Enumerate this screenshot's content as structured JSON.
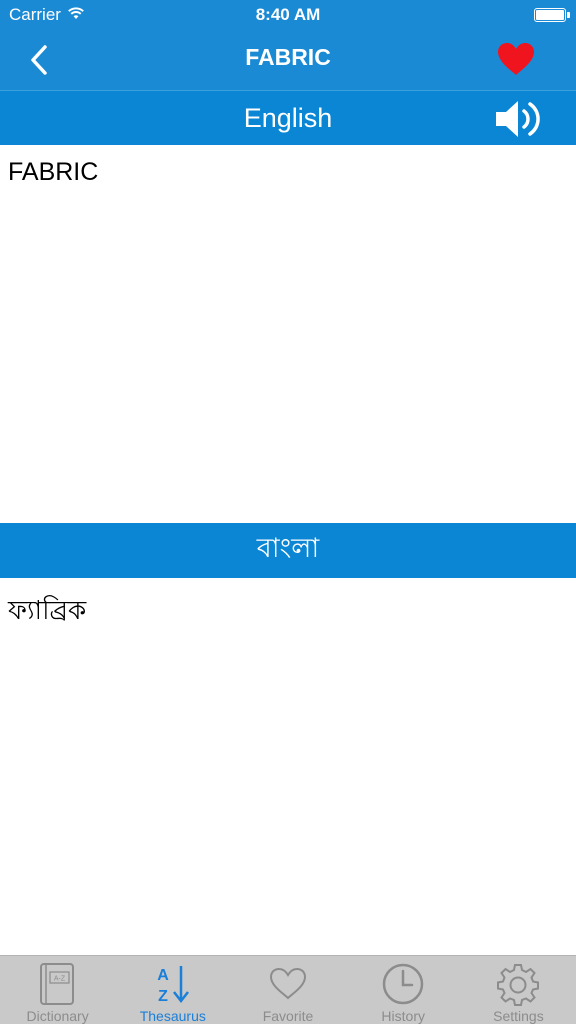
{
  "status_bar": {
    "carrier": "Carrier",
    "time": "8:40 AM"
  },
  "nav_bar": {
    "title": "FABRIC"
  },
  "sections": {
    "english_header": "English",
    "english_text": "FABRIC",
    "bangla_header": "বাংলা",
    "bangla_text": "ফ্যাব্রিক"
  },
  "tabs": [
    {
      "label": "Dictionary",
      "icon": "dictionary-book-icon",
      "active": false
    },
    {
      "label": "Thesaurus",
      "icon": "az-sort-icon",
      "active": true
    },
    {
      "label": "Favorite",
      "icon": "heart-outline-icon",
      "active": false
    },
    {
      "label": "History",
      "icon": "clock-icon",
      "active": false
    },
    {
      "label": "Settings",
      "icon": "gear-icon",
      "active": false
    }
  ],
  "colors": {
    "nav_background": "#1a8ad4",
    "section_header": "#0a86d4",
    "favorite_heart": "#f0141e",
    "tab_active": "#1a7fd9",
    "tab_inactive": "#8c8c8c",
    "tab_bar_background": "#c9c9c9"
  }
}
